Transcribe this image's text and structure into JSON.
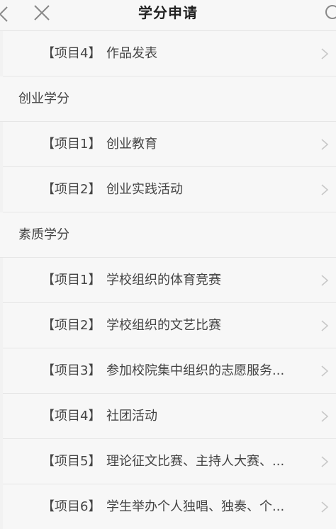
{
  "header": {
    "title": "学分申请",
    "icons": {
      "back": "chevron-left-icon",
      "close": "close-icon",
      "more": "circle-icon"
    }
  },
  "list": [
    {
      "kind": "item",
      "tag": "【项目4】",
      "name": "作品发表"
    },
    {
      "kind": "section",
      "label": "创业学分"
    },
    {
      "kind": "item",
      "tag": "【项目1】",
      "name": "创业教育"
    },
    {
      "kind": "item",
      "tag": "【项目2】",
      "name": "创业实践活动"
    },
    {
      "kind": "section",
      "label": "素质学分"
    },
    {
      "kind": "item",
      "tag": "【项目1】",
      "name": "学校组织的体育竞赛"
    },
    {
      "kind": "item",
      "tag": "【项目2】",
      "name": "学校组织的文艺比赛"
    },
    {
      "kind": "item",
      "tag": "【项目3】",
      "name": "参加校院集中组织的志愿服务..."
    },
    {
      "kind": "item",
      "tag": "【项目4】",
      "name": "社团活动"
    },
    {
      "kind": "item",
      "tag": "【项目5】",
      "name": "理论征文比赛、主持人大赛、..."
    },
    {
      "kind": "item",
      "tag": "【项目6】",
      "name": "学生举办个人独唱、独奏、个..."
    }
  ],
  "colors": {
    "background": "#f2f2f2",
    "row_background": "#f7f7f7",
    "text": "#444444",
    "chevron": "#c8c8c8"
  }
}
